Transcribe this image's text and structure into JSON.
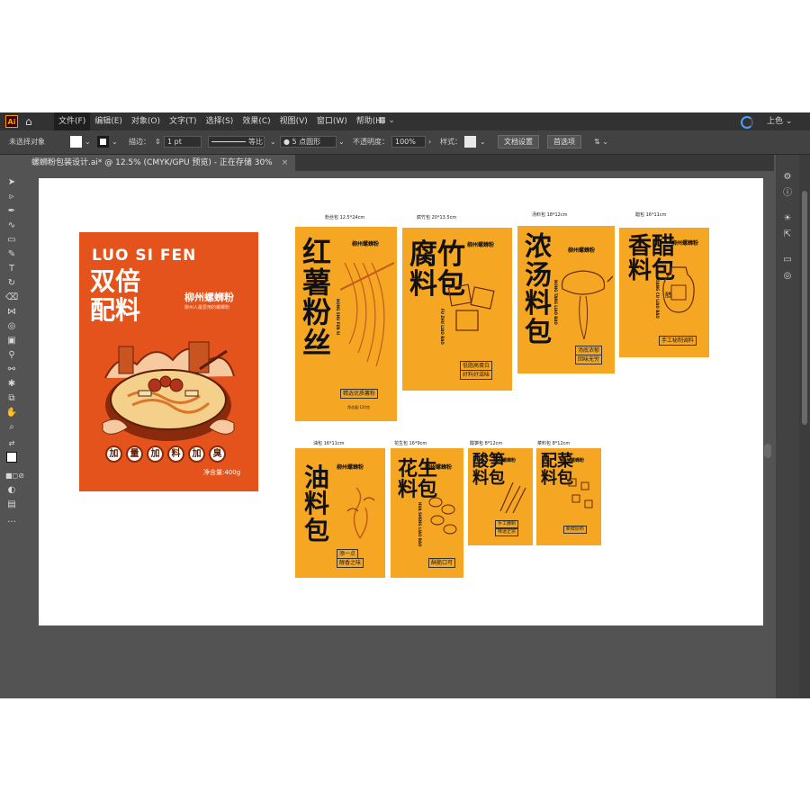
{
  "menubar": {
    "logo": "Ai",
    "items": [
      "文件(F)",
      "编辑(E)",
      "对象(O)",
      "文字(T)",
      "选择(S)",
      "效果(C)",
      "视图(V)",
      "窗口(W)",
      "帮助(H)"
    ],
    "workspace": "上色"
  },
  "controlbar": {
    "selection": "未选择对象",
    "stroke_label": "描边：",
    "stroke_value": "1 pt",
    "ratio_label": "等比",
    "brush_label": "5 点圆形",
    "opacity_label": "不透明度：",
    "opacity_value": "100%",
    "style_label": "样式：",
    "doc_setup": "文档设置",
    "preferences": "首选项"
  },
  "document": {
    "tab_title": "螺蛳粉包装设计.ai* @ 12.5% (CMYK/GPU 预览) - 正在存储 30%",
    "close": "×"
  },
  "poster": {
    "brand": "LUO SI FEN",
    "headline_1": "双倍",
    "headline_2": "配料",
    "city": "柳州螺蛳粉",
    "subline": "柳州人最爱用的螺蛳粉",
    "chips": [
      "加",
      "量",
      "加",
      "料",
      "加",
      "臭"
    ],
    "weight": "净含量:400g"
  },
  "packs": {
    "p1": {
      "label": "粉丝包 12.5*24cm",
      "title": "红薯粉丝",
      "brand": "柳州螺蛳粉",
      "pinyin": "HONG SHU FEN SI",
      "tag": "精选优质薯粉",
      "net": "净含量:120克"
    },
    "p2": {
      "label": "腐竹包 20*13.5cm",
      "title": "腐竹料包",
      "brand": "柳州螺蛳粉",
      "pinyin": "FU ZHU LIAO BAO",
      "tag1": "低脂高蛋白",
      "tag2": "好料好滋味"
    },
    "p3": {
      "label": "汤料包 18*12cm",
      "title": "浓汤料包",
      "brand": "柳州螺蛳粉",
      "pinyin": "NONG TANG LIAO BAO",
      "tag1": "汤底浓郁",
      "tag2": "回味无穷"
    },
    "p4": {
      "label": "醋包 16*11cm",
      "title": "香醋料包",
      "brand": "柳州螺蛳粉",
      "pinyin": "XIANG CU LIAO BAO",
      "tag": "手工秘制调料",
      "jar": "醋"
    },
    "p5": {
      "label": "油包 16*11cm",
      "title": "油料包",
      "brand": "柳州螺蛳粉",
      "tag1": "添一点",
      "tag2": "醇香之味"
    },
    "p6": {
      "label": "花生包 16*9cm",
      "title": "花生料包",
      "brand": "柳州螺蛳粉",
      "pinyin": "HUA SHENG LIAO BAO",
      "tag": "酥脆口可"
    },
    "p7": {
      "label": "酸笋包 8*12cm",
      "title": "酸笋料包",
      "brand": "柳州螺蛳粉",
      "tag1": "手工腌制",
      "tag2": "味道正宗"
    },
    "p8": {
      "label": "菜料包 8*12cm",
      "title": "配菜料包",
      "brand": "柳州螺蛳粉",
      "tag": "新鲜原料"
    }
  },
  "colors": {
    "accent": "#f5a623",
    "poster_bg": "#e4531c",
    "ink": "#111111"
  }
}
